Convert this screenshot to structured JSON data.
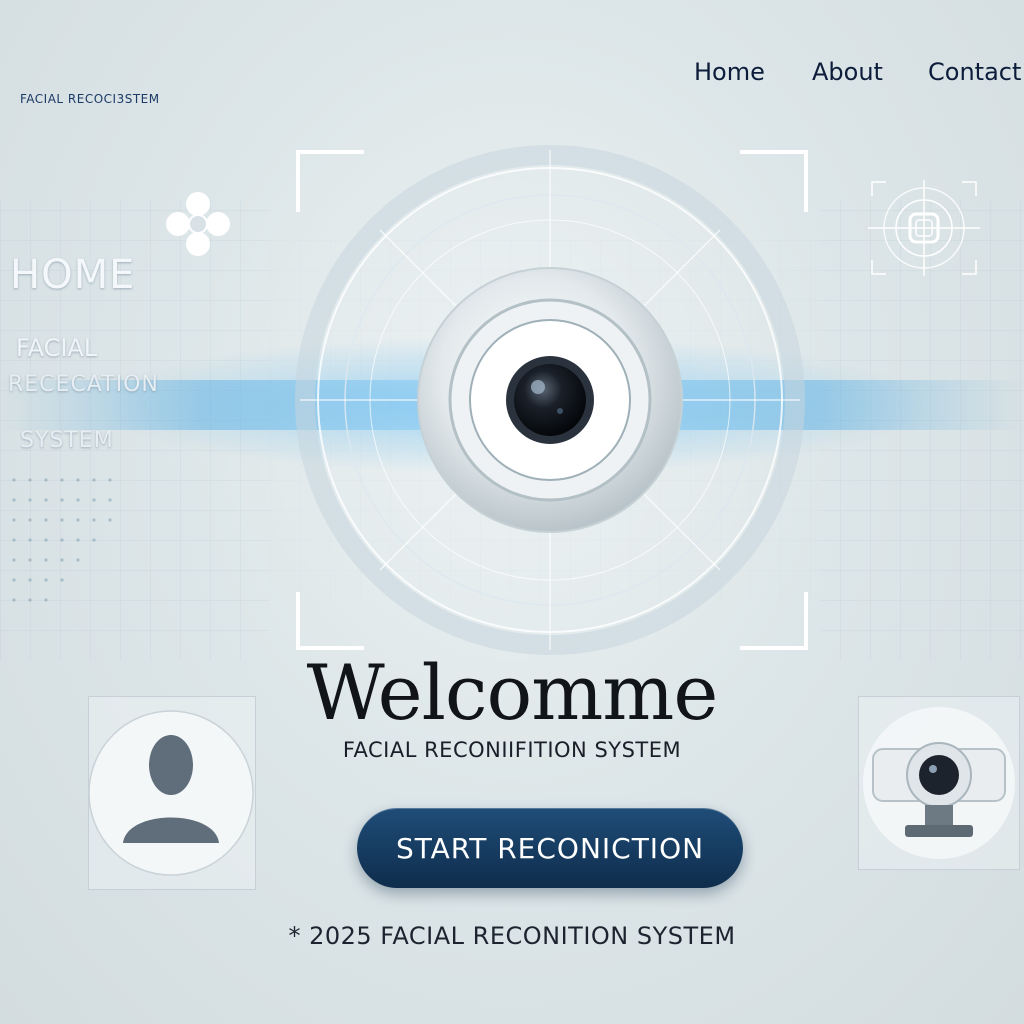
{
  "brand": {
    "name": "FACIAL RECOCI3STEM"
  },
  "nav": {
    "items": [
      "Home",
      "About",
      "Contact"
    ]
  },
  "sidebar": {
    "home_label": "HOME",
    "line1": "FACIAL",
    "line2": "RECECATION",
    "line3": "SYSTEM"
  },
  "hero": {
    "title": "Welcomme",
    "subtitle": "FACIAL RECONIIFITION SYSTEM"
  },
  "cta": {
    "label": "START RECONICTION"
  },
  "footer": {
    "text": "* 2025 FACIAL RECONITION SYSTEM"
  },
  "icons": [
    "flower-icon",
    "scanner-target-icon",
    "camera-lens-icon",
    "user-avatar-icon",
    "webcam-icon"
  ],
  "colors": {
    "accent": "#1f4d78",
    "glow": "#3aa0e0",
    "background": "#dde6e8"
  }
}
